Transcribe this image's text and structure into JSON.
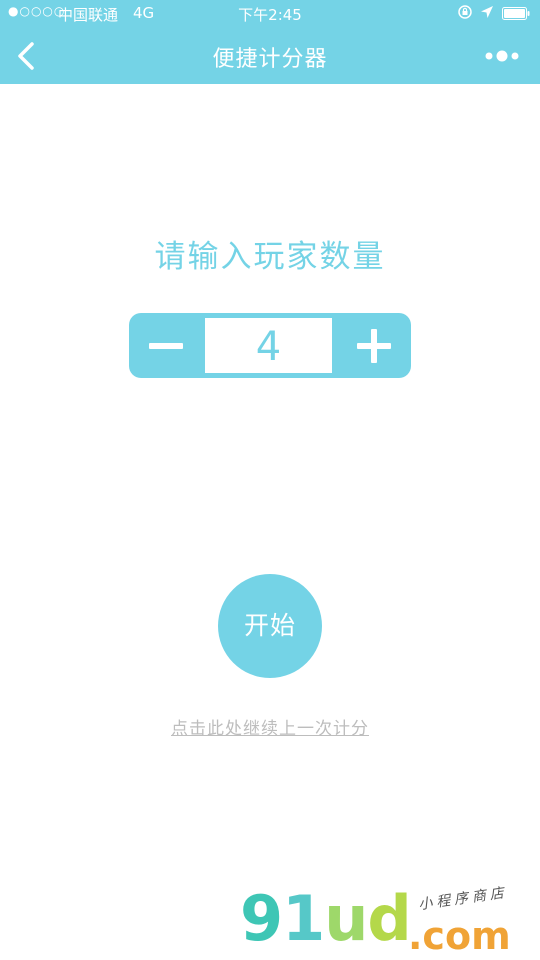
{
  "status_bar": {
    "signal": "●○○○○",
    "carrier": "中国联通",
    "network": "4G",
    "time": "下午2:45"
  },
  "nav": {
    "title": "便捷计分器",
    "back_icon": "chevron-left-icon",
    "more_icon": "more-dots-icon"
  },
  "main": {
    "prompt": "请输入玩家数量",
    "player_count": "4",
    "start_label": "开始",
    "continue_label": "点击此处继续上一次计分"
  },
  "watermark": {
    "logo_text": "91ud",
    "domain_text": ".com",
    "tagline": "小程序商店"
  },
  "colors": {
    "accent": "#74d3e6",
    "link_gray": "#bdbdbd"
  }
}
